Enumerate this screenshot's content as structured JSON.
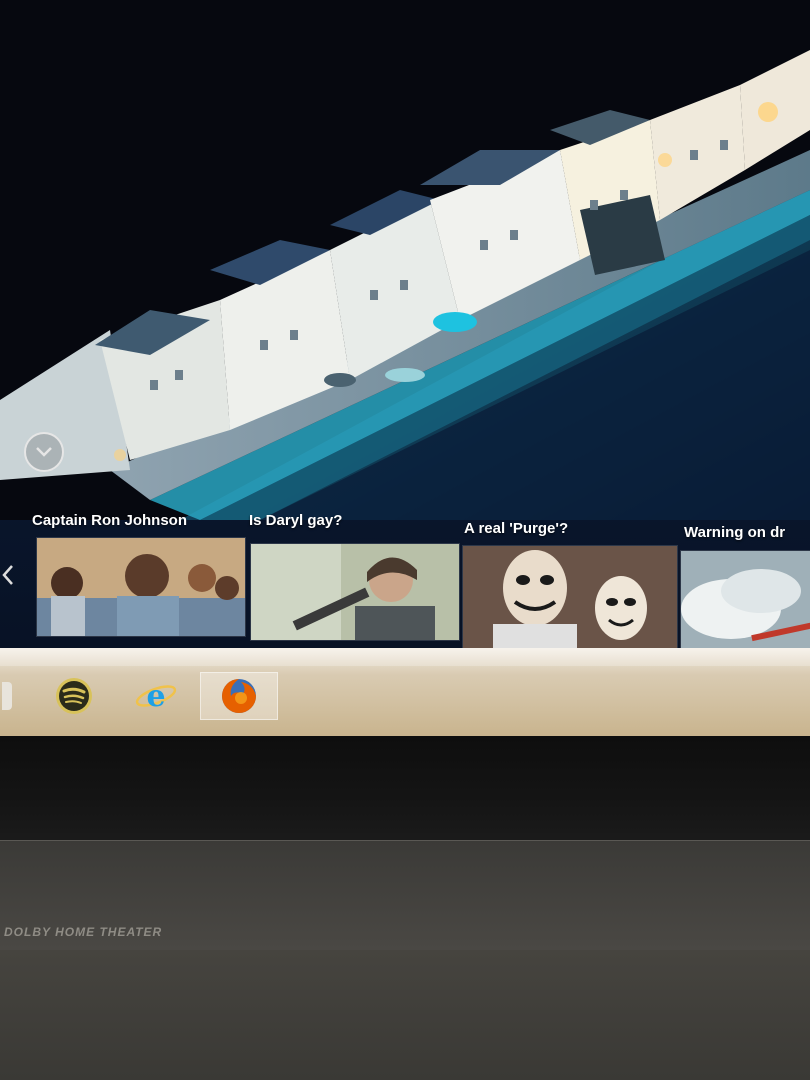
{
  "news": {
    "items": [
      {
        "title": "Captain Ron Johnson"
      },
      {
        "title": "Is Daryl gay?"
      },
      {
        "title": "A real 'Purge'?"
      },
      {
        "title": "Warning on dr"
      }
    ]
  },
  "taskbar": {
    "apps": [
      {
        "name": "Spotify",
        "icon": "spotify-icon"
      },
      {
        "name": "Internet Explorer",
        "icon": "internet-explorer-icon"
      },
      {
        "name": "Firefox",
        "icon": "firefox-icon",
        "active": true
      }
    ]
  },
  "bezel": {
    "brand_label": "DOLBY HOME THEATER"
  },
  "colors": {
    "taskbar": "#d9cbb2",
    "water": "#0a1830",
    "spotify": "#1db954",
    "firefox": "#e66000",
    "ie": "#1ea0e6"
  }
}
